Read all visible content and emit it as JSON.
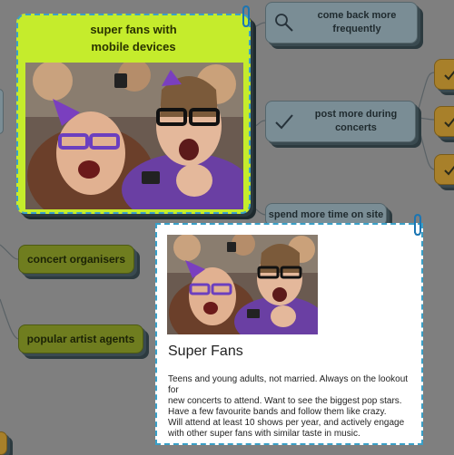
{
  "featured_node": {
    "title_line1": "super fans with",
    "title_line2": "mobile devices"
  },
  "nodes": {
    "come_back": {
      "line1": "come back more",
      "line2": "frequently",
      "icon": "magnifier-icon"
    },
    "post_more": {
      "line1": "post more during",
      "line2": "concerts",
      "icon": "checkmark-icon"
    },
    "spend_time": {
      "label": "spend more time on site"
    },
    "concert_organisers": {
      "label": "concert organisers"
    },
    "popular_artist_agents": {
      "label": "popular artist agents"
    }
  },
  "popup": {
    "title": "Super Fans",
    "description_lines": [
      "Teens and young adults, not married. Always on the lookout for",
      "new concerts to attend. Want to see the biggest pop stars.",
      "Have a few favourite bands and follow them like crazy.",
      "Will attend at least 10 shows per year, and actively engage",
      "with other super fans with similar taste in music."
    ]
  },
  "colors": {
    "canvas": "#7f7f7f",
    "featured_fill": "#c5ec2c",
    "selection_border": "#3aa0c8",
    "grey_node": "#7a8d95",
    "green_node": "#6f7d1f",
    "orange_node": "#a8802a"
  },
  "icons": [
    "paperclip-icon",
    "magnifier-icon",
    "checkmark-icon"
  ]
}
